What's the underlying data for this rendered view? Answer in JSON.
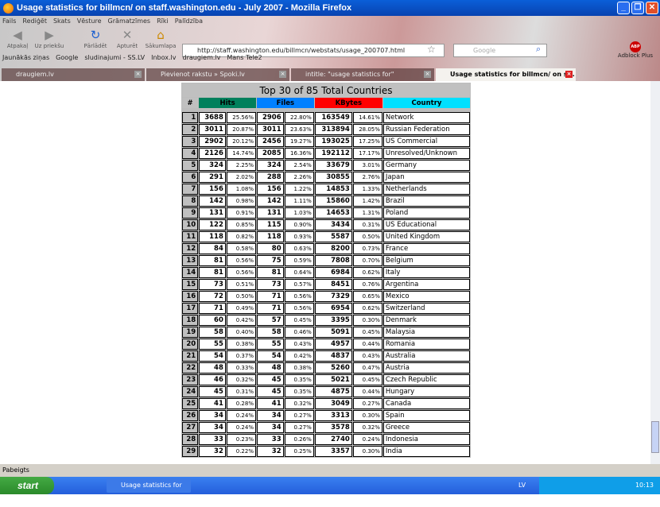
{
  "window": {
    "title": "Usage statistics for billmcn/ on staff.washington.edu - July 2007 - Mozilla Firefox"
  },
  "menu": [
    "Fails",
    "Rediģēt",
    "Skats",
    "Vēsture",
    "Grāmatzīmes",
    "Rīki",
    "Palīdzība"
  ],
  "nav": {
    "back": "Atpakaļ",
    "forward": "Uz priekšu",
    "reload": "Pārlādēt",
    "stop": "Apturēt",
    "home": "Sākumlapa",
    "url": "http://staff.washington.edu/billmcn/webstats/usage_200707.html",
    "search_placeholder": "Google",
    "abp": "Adblock Plus"
  },
  "bookmarks": [
    "Jaunākās ziņas",
    "Google",
    "sludinajumi - SS.LV",
    "Inbox.lv",
    "draugiem.lv",
    "Mans Tele2"
  ],
  "tabs": [
    {
      "label": "draugiem.lv"
    },
    {
      "label": "Pievienot rakstu » Spoki.lv"
    },
    {
      "label": "intitle: \"usage statistics for\" \"generated..."
    },
    {
      "label": "Usage statistics for billmcn/ on s...",
      "active": true
    }
  ],
  "table": {
    "title": "Top 30 of 85 Total Countries",
    "headers": {
      "num": "#",
      "hits": "Hits",
      "files": "Files",
      "kbytes": "KBytes",
      "country": "Country"
    },
    "header_colors": {
      "hits": "#00805c",
      "files": "#0080ff",
      "kbytes": "#ff0000",
      "country": "#00e0ff"
    },
    "rows": [
      [
        1,
        3688,
        "25.56%",
        2906,
        "22.80%",
        163549,
        "14.61%",
        "Network"
      ],
      [
        2,
        3011,
        "20.87%",
        3011,
        "23.63%",
        313894,
        "28.05%",
        "Russian Federation"
      ],
      [
        3,
        2902,
        "20.12%",
        2456,
        "19.27%",
        193025,
        "17.25%",
        "US Commercial"
      ],
      [
        4,
        2126,
        "14.74%",
        2085,
        "16.36%",
        192112,
        "17.17%",
        "Unresolved/Unknown"
      ],
      [
        5,
        324,
        "2.25%",
        324,
        "2.54%",
        33679,
        "3.01%",
        "Germany"
      ],
      [
        6,
        291,
        "2.02%",
        288,
        "2.26%",
        30855,
        "2.76%",
        "Japan"
      ],
      [
        7,
        156,
        "1.08%",
        156,
        "1.22%",
        14853,
        "1.33%",
        "Netherlands"
      ],
      [
        8,
        142,
        "0.98%",
        142,
        "1.11%",
        15860,
        "1.42%",
        "Brazil"
      ],
      [
        9,
        131,
        "0.91%",
        131,
        "1.03%",
        14653,
        "1.31%",
        "Poland"
      ],
      [
        10,
        122,
        "0.85%",
        115,
        "0.90%",
        3434,
        "0.31%",
        "US Educational"
      ],
      [
        11,
        118,
        "0.82%",
        118,
        "0.93%",
        5587,
        "0.50%",
        "United Kingdom"
      ],
      [
        12,
        84,
        "0.58%",
        80,
        "0.63%",
        8200,
        "0.73%",
        "France"
      ],
      [
        13,
        81,
        "0.56%",
        75,
        "0.59%",
        7808,
        "0.70%",
        "Belgium"
      ],
      [
        14,
        81,
        "0.56%",
        81,
        "0.64%",
        6984,
        "0.62%",
        "Italy"
      ],
      [
        15,
        73,
        "0.51%",
        73,
        "0.57%",
        8451,
        "0.76%",
        "Argentina"
      ],
      [
        16,
        72,
        "0.50%",
        71,
        "0.56%",
        7329,
        "0.65%",
        "Mexico"
      ],
      [
        17,
        71,
        "0.49%",
        71,
        "0.56%",
        6954,
        "0.62%",
        "Switzerland"
      ],
      [
        18,
        60,
        "0.42%",
        57,
        "0.45%",
        3395,
        "0.30%",
        "Denmark"
      ],
      [
        19,
        58,
        "0.40%",
        58,
        "0.46%",
        5091,
        "0.45%",
        "Malaysia"
      ],
      [
        20,
        55,
        "0.38%",
        55,
        "0.43%",
        4957,
        "0.44%",
        "Romania"
      ],
      [
        21,
        54,
        "0.37%",
        54,
        "0.42%",
        4837,
        "0.43%",
        "Australia"
      ],
      [
        22,
        48,
        "0.33%",
        48,
        "0.38%",
        5260,
        "0.47%",
        "Austria"
      ],
      [
        23,
        46,
        "0.32%",
        45,
        "0.35%",
        5021,
        "0.45%",
        "Czech Republic"
      ],
      [
        24,
        45,
        "0.31%",
        45,
        "0.35%",
        4875,
        "0.44%",
        "Hungary"
      ],
      [
        25,
        41,
        "0.28%",
        41,
        "0.32%",
        3049,
        "0.27%",
        "Canada"
      ],
      [
        26,
        34,
        "0.24%",
        34,
        "0.27%",
        3313,
        "0.30%",
        "Spain"
      ],
      [
        27,
        34,
        "0.24%",
        34,
        "0.27%",
        3578,
        "0.32%",
        "Greece"
      ],
      [
        28,
        33,
        "0.23%",
        33,
        "0.26%",
        2740,
        "0.24%",
        "Indonesia"
      ],
      [
        29,
        32,
        "0.22%",
        32,
        "0.25%",
        3357,
        "0.30%",
        "India"
      ]
    ]
  },
  "status": "Pabeigts",
  "taskbar": {
    "start": "start",
    "task": "Usage statistics for bi...",
    "lang": "LV",
    "clock": "10:13"
  }
}
